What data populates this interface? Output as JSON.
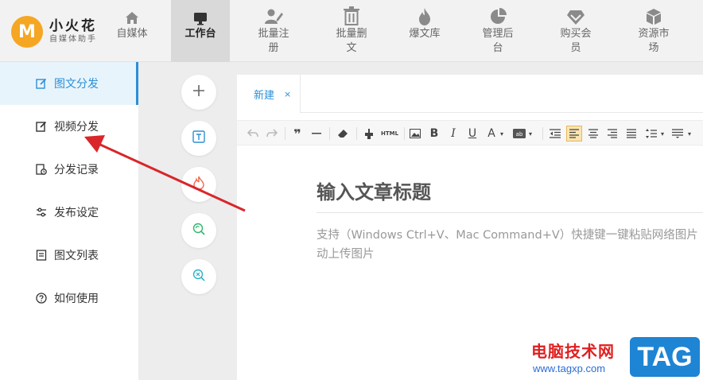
{
  "brand": {
    "title": "小火花",
    "subtitle": "自媒体助手",
    "logo_letter": "M",
    "color": "#f5a623"
  },
  "nav": [
    {
      "label": "自媒体",
      "icon": "home-icon"
    },
    {
      "label": "工作台",
      "icon": "monitor-icon",
      "active": true
    },
    {
      "label": "批量注册",
      "icon": "user-edit-icon"
    },
    {
      "label": "批量删文",
      "icon": "trash-icon"
    },
    {
      "label": "爆文库",
      "icon": "flame-icon"
    },
    {
      "label": "管理后台",
      "icon": "pie-chart-icon"
    },
    {
      "label": "购买会员",
      "icon": "diamond-icon"
    },
    {
      "label": "资源市场",
      "icon": "cube-icon"
    }
  ],
  "sidebar": {
    "items": [
      {
        "label": "图文分发",
        "icon": "edit-square-icon",
        "active": true
      },
      {
        "label": "视频分发",
        "icon": "edit-square-icon"
      },
      {
        "label": "分发记录",
        "icon": "record-icon"
      },
      {
        "label": "发布设定",
        "icon": "sliders-icon"
      },
      {
        "label": "图文列表",
        "icon": "list-doc-icon"
      },
      {
        "label": "如何使用",
        "icon": "help-circle-icon"
      }
    ]
  },
  "tools": [
    {
      "icon": "plus-icon"
    },
    {
      "icon": "text-box-icon"
    },
    {
      "icon": "fire-icon"
    },
    {
      "icon": "search-refresh-icon"
    },
    {
      "icon": "search-close-icon"
    }
  ],
  "editor": {
    "tab_label": "新建",
    "tab_close": "×",
    "title_placeholder": "输入文章标题",
    "hint_line1": "支持（Windows Ctrl+V、Mac Command+V）快捷键一键粘贴网络图片",
    "hint_line2": "动上传图片",
    "toolbar": {
      "bold": "B",
      "italic": "I",
      "underline": "U",
      "font_color": "A",
      "html": "HTML"
    }
  },
  "watermark": {
    "cn": "电脑技术网",
    "url": "www.tagxp.com",
    "tag": "TAG"
  },
  "colors": {
    "accent": "#2b8fd6",
    "arrow": "#d9262a",
    "active_nav_bg": "#d9d9d9"
  }
}
